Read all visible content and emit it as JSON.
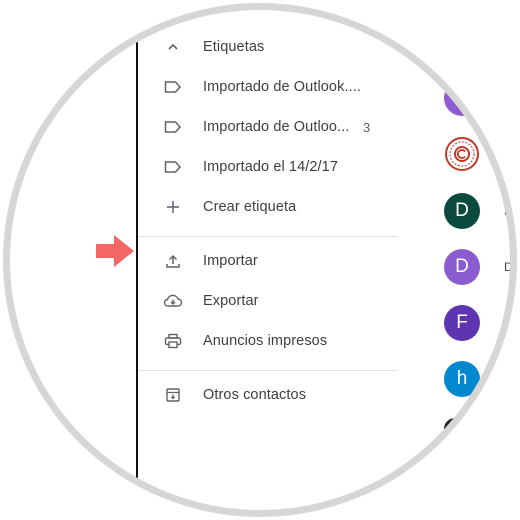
{
  "labels_section": {
    "header": "Etiquetas",
    "items": [
      {
        "label": "Importado de Outlook....",
        "count": ""
      },
      {
        "label": "Importado de Outloo...",
        "count": "3"
      },
      {
        "label": "Importado el 14/2/17",
        "count": ""
      }
    ],
    "create_label": "Crear etiqueta"
  },
  "actions": {
    "import": "Importar",
    "export": "Exportar",
    "print": "Anuncios impresos"
  },
  "other_contacts": "Otros contactos",
  "contacts": [
    {
      "initial": "",
      "color": "#8e5bd1"
    },
    {
      "initial": "",
      "color": "#c0392b"
    },
    {
      "initial": "D",
      "color": "#0b4a3e",
      "side": "L"
    },
    {
      "initial": "D",
      "color": "#8a5cd0",
      "side": "D"
    },
    {
      "initial": "F",
      "color": "#5e35b1"
    },
    {
      "initial": "h",
      "color": "#0288d1"
    }
  ],
  "colors": {
    "highlight_arrow": "#f26666"
  },
  "icons": [
    "chevron-up-icon",
    "label-icon",
    "plus-icon",
    "upload-icon",
    "cloud-download-icon",
    "printer-icon",
    "archive-icon",
    "arrow-right-icon"
  ]
}
